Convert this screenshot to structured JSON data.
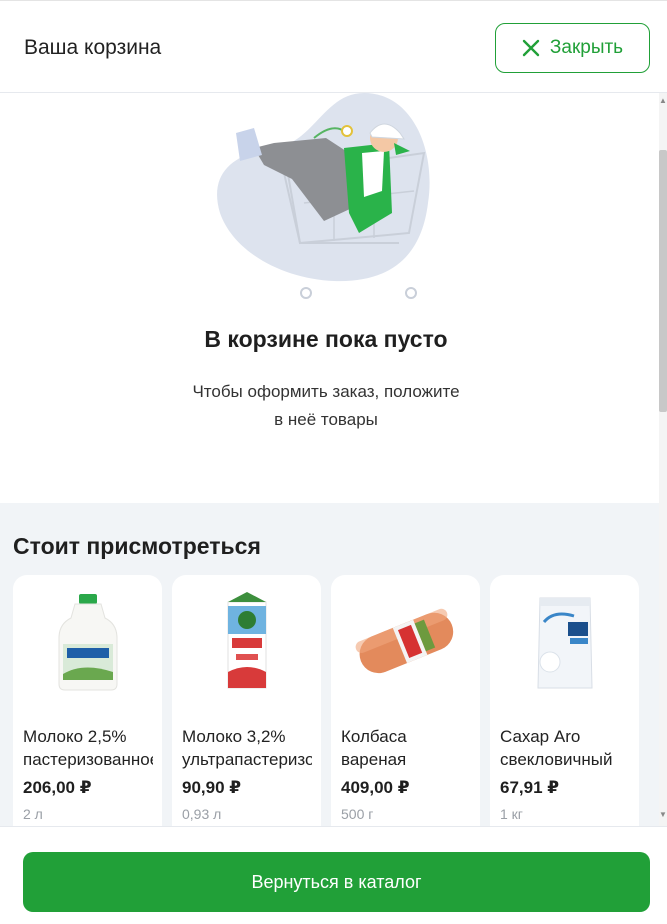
{
  "header": {
    "title": "Ваша корзина",
    "close_label": "Закрыть"
  },
  "empty": {
    "title": "В корзине пока пусто",
    "subtitle_line1": "Чтобы оформить заказ, положите",
    "subtitle_line2": "в неё товары"
  },
  "recommendations": {
    "title": "Стоит присмотреться",
    "items": [
      {
        "name_line1": "Молоко 2,5%",
        "name_line2": "пастеризованное",
        "price": "206,00 ₽",
        "unit": "2 л",
        "icon": "milk-bottle-icon"
      },
      {
        "name_line1": "Молоко 3,2%",
        "name_line2": "ультрапастеризованное",
        "price": "90,90 ₽",
        "unit": "0,93 л",
        "icon": "milk-carton-icon"
      },
      {
        "name_line1": "Колбаса",
        "name_line2": "вареная",
        "price": "409,00 ₽",
        "unit": "500 г",
        "icon": "sausage-icon"
      },
      {
        "name_line1": "Сахар Aro",
        "name_line2": "свекловичный",
        "price": "67,91 ₽",
        "unit": "1 кг",
        "icon": "sugar-bag-icon"
      }
    ]
  },
  "footer": {
    "back_label": "Вернуться в каталог"
  },
  "colors": {
    "accent": "#21a038",
    "section_bg": "#f1f4f7",
    "illustration_blob": "#dde3ee"
  }
}
